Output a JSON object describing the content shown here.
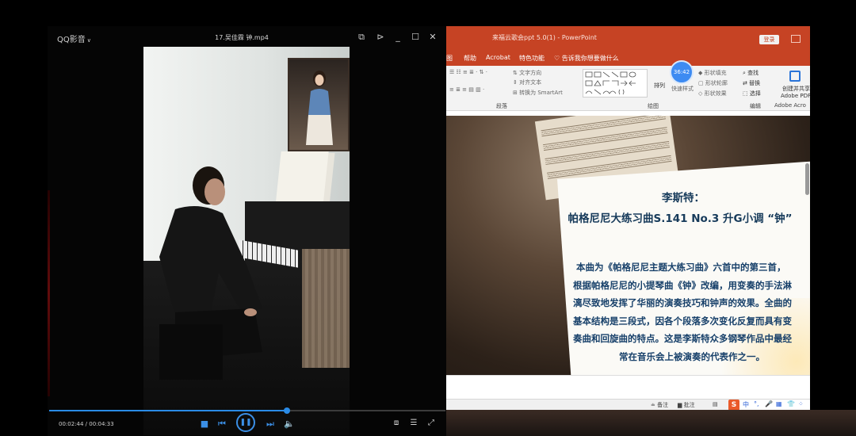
{
  "player": {
    "app_name": "QQ影音",
    "file_title": "17.吴佳霖 钟.mp4",
    "current_time": "00:02:44",
    "total_time": "00:04:33",
    "progress_fraction": 0.6,
    "accent_color": "#2a8be6"
  },
  "ppt": {
    "doc_title": "来福云歌会ppt 5.0(1) - PowerPoint",
    "login_label": "登录",
    "tabs": [
      "图",
      "帮助",
      "Acrobat",
      "特色功能",
      "♡ 告诉我你想要做什么"
    ],
    "ribbon": {
      "text_direction": "文字方向",
      "align_text": "对齐文本",
      "convert_smartart": "转换为 SmartArt",
      "paragraph_label": "段落",
      "drawing_label": "绘图",
      "arrange": "排列",
      "quick_styles": "快速样式",
      "shape_fill": "形状填充",
      "shape_outline": "形状轮廓",
      "shape_effects": "形状效果",
      "find": "查找",
      "replace": "替换",
      "select": "选择",
      "editing_label": "编辑",
      "create_share": "创建并共享",
      "adobe_pdf": "Adobe PDF",
      "adobe_acrobat": "Adobe Acro",
      "timer": "36:42"
    },
    "slide": {
      "heading_line1": "李斯特：",
      "heading_line2": "帕格尼尼大练习曲S.141 No.3 升G小调 “钟”",
      "body_lines": [
        "本曲为《帕格尼尼主题大练习曲》六首中的第三首，",
        "根据帕格尼尼的小提琴曲《钟》改编，用变奏的手法淋",
        "漓尽致地发挥了华丽的演奏技巧和钟声的效果。全曲的",
        "基本结构是三段式，因各个段落多次变化反复而具有变",
        "奏曲和回旋曲的特点。这是李斯特众多钢琴作品中最经",
        "常在音乐会上被演奏的代表作之一。"
      ]
    },
    "statusbar": {
      "notes": "备注",
      "comments": "批注",
      "ime_logo": "S",
      "ime_mode": "中"
    },
    "accent_color": "#c64324"
  }
}
